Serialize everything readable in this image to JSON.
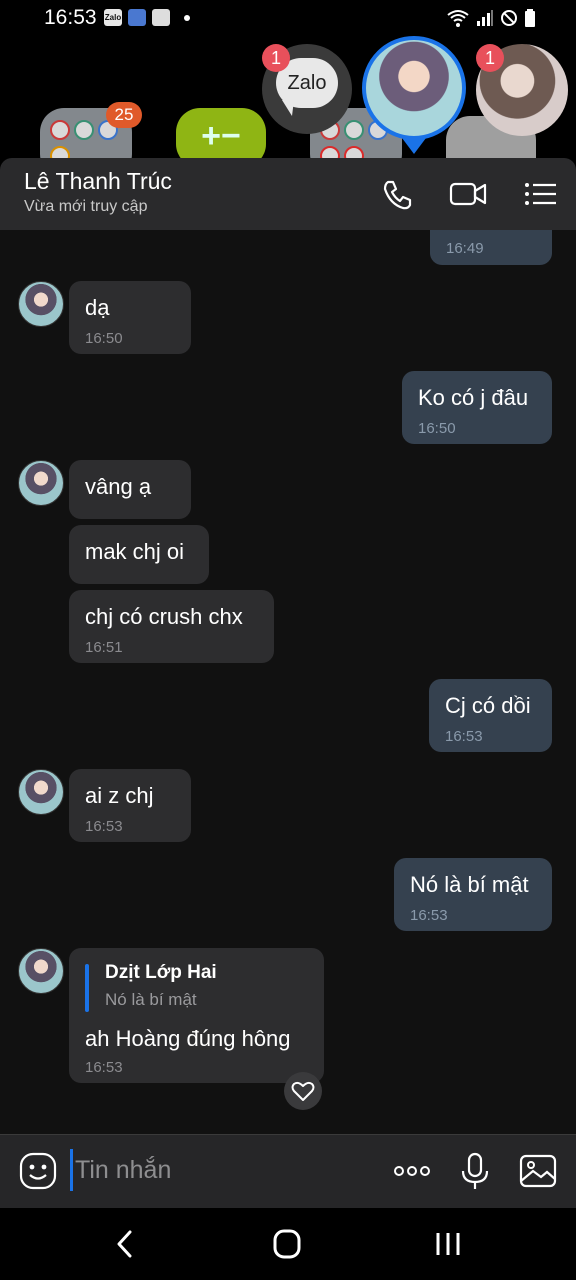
{
  "status_bar": {
    "time": "16:53",
    "apps": [
      "Zalo",
      "",
      ""
    ]
  },
  "home_screen": {
    "folder_badge": "25"
  },
  "chat_heads": {
    "zalo_label": "Zalo",
    "zalo_badge": "1",
    "third_badge": "1"
  },
  "header": {
    "contact_name": "Lê Thanh Trúc",
    "contact_status": "Vừa mới truy cập"
  },
  "messages": [
    {
      "text": "",
      "time": "16:49"
    },
    {
      "text": "dạ",
      "time": "16:50"
    },
    {
      "text": "Ko có j đâu",
      "time": "16:50"
    },
    {
      "text": "vâng ạ",
      "time": ""
    },
    {
      "text": "mak chj oi",
      "time": ""
    },
    {
      "text": "chj có crush chx",
      "time": "16:51"
    },
    {
      "text": "Cj có dồi",
      "time": "16:53"
    },
    {
      "text": "ai z chj",
      "time": "16:53"
    },
    {
      "text": "Nó là bí mật",
      "time": "16:53"
    },
    {
      "reply_name": "Dzịt Lớp Hai",
      "reply_text": "Nó là bí mật",
      "text": "ah Hoàng đúng hông",
      "time": "16:53"
    }
  ],
  "input": {
    "placeholder": "Tin nhắn"
  },
  "colors": {
    "accent": "#1a73e8",
    "incoming_bubble": "#2d2d2f",
    "outgoing_bubble": "#35414f",
    "header_bg": "#2a2a2c",
    "badge": "#e8505b"
  },
  "icons": {
    "header": [
      "phone-icon",
      "video-call-icon",
      "menu-list-icon"
    ],
    "input_bar": [
      "emoji-icon",
      "more-dots-icon",
      "microphone-icon",
      "image-icon"
    ],
    "nav": [
      "back-icon",
      "home-icon",
      "recents-icon"
    ]
  }
}
